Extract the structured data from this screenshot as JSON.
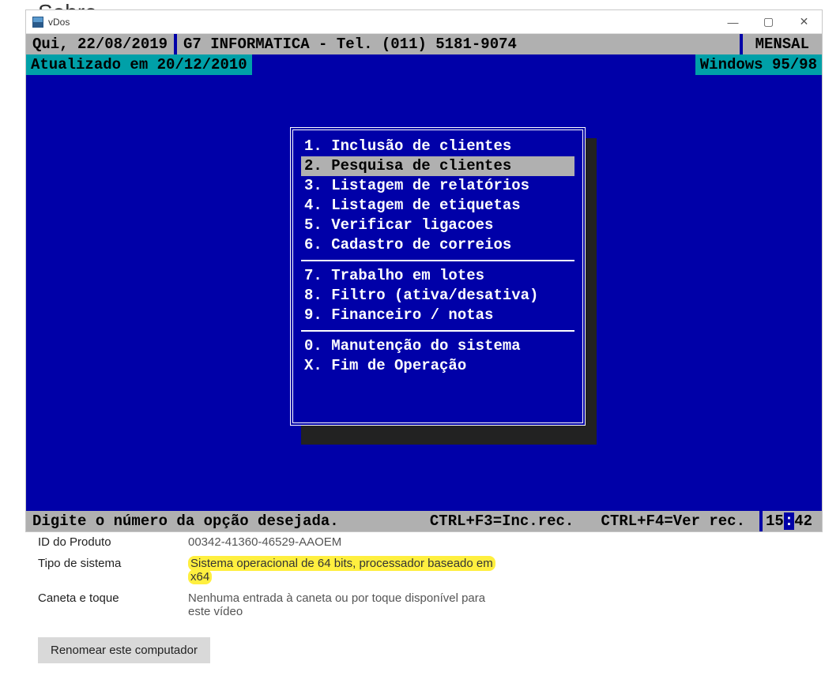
{
  "background_heading": "Sobre",
  "window": {
    "title": "vDos",
    "controls": {
      "min": "—",
      "max": "▢",
      "close": "✕"
    }
  },
  "dos": {
    "top": {
      "date": "Qui, 22/08/2019",
      "company": "G7 INFORMATICA - Tel. (011) 5181-9074",
      "mode": "MENSAL"
    },
    "second": {
      "updated": "Atualizado em 20/12/2010",
      "os": "Windows 95/98"
    },
    "menu": [
      {
        "num": "1.",
        "label": "Inclusão de clientes",
        "selected": false
      },
      {
        "num": "2.",
        "label": "Pesquisa de clientes",
        "selected": true
      },
      {
        "num": "3.",
        "label": "Listagem de relatórios",
        "selected": false
      },
      {
        "num": "4.",
        "label": "Listagem de etiquetas",
        "selected": false
      },
      {
        "num": "5.",
        "label": "Verificar ligacoes",
        "selected": false
      },
      {
        "num": "6.",
        "label": "Cadastro de correios",
        "selected": false
      },
      {
        "sep": true
      },
      {
        "num": "7.",
        "label": "Trabalho em lotes",
        "selected": false
      },
      {
        "num": "8.",
        "label": "Filtro (ativa/desativa)",
        "selected": false
      },
      {
        "num": "9.",
        "label": "Financeiro / notas",
        "selected": false
      },
      {
        "sep": true
      },
      {
        "num": "0.",
        "label": "Manutenção do sistema",
        "selected": false
      },
      {
        "num": "X.",
        "label": "Fim de Operação",
        "selected": false
      }
    ],
    "bottom": {
      "prompt": "Digite o número da opção desejada.",
      "hint1": "CTRL+F3=Inc.rec.",
      "hint2": "CTRL+F4=Ver rec.",
      "time_h": "15",
      "time_m": "42"
    }
  },
  "info": {
    "rows": [
      {
        "label": "ID do Produto",
        "value": "00342-41360-46529-AAOEM",
        "highlight": false
      },
      {
        "label": "Tipo de sistema",
        "value": "Sistema operacional de 64 bits, processador baseado em x64",
        "highlight": true
      },
      {
        "label": "Caneta e toque",
        "value": "Nenhuma entrada à caneta ou por toque disponível para este vídeo",
        "highlight": false
      }
    ],
    "rename_button": "Renomear este computador"
  }
}
